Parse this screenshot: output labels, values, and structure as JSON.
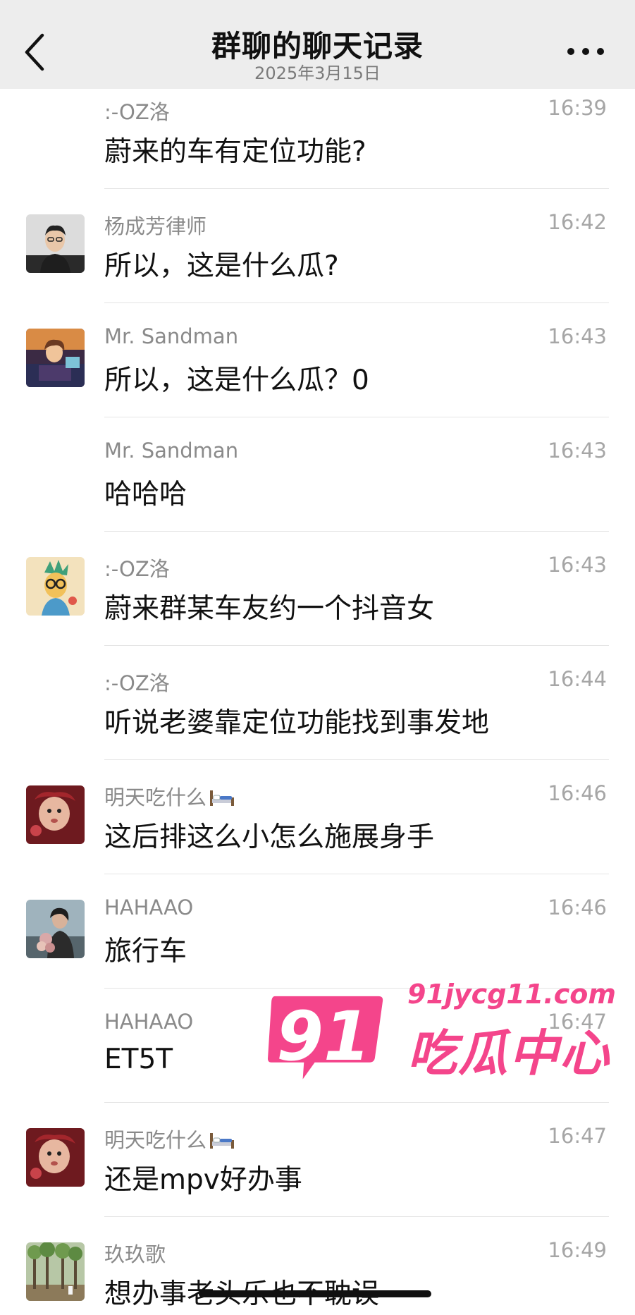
{
  "header": {
    "title": "群聊的聊天记录",
    "date": "2025年3月15日"
  },
  "messages": [
    {
      "sender": ":-OZ洛",
      "time": "16:39",
      "text": "蔚来的车有定位功能?",
      "avatar": "none"
    },
    {
      "sender": "杨成芳律师",
      "time": "16:42",
      "text": "所以，这是什么瓜?",
      "avatar": "portrait-man-glasses"
    },
    {
      "sender": "Mr. Sandman",
      "time": "16:43",
      "text": "所以，这是什么瓜？0",
      "avatar": "anime-character"
    },
    {
      "sender": "Mr. Sandman",
      "time": "16:43",
      "text": "哈哈哈",
      "avatar": "none"
    },
    {
      "sender": ":-OZ洛",
      "time": "16:43",
      "text": "蔚来群某车友约一个抖音女",
      "avatar": "cartoon-glasses"
    },
    {
      "sender": ":-OZ洛",
      "time": "16:44",
      "text": "听说老婆靠定位功能找到事发地",
      "avatar": "none"
    },
    {
      "sender": "明天吃什么",
      "time": "16:46",
      "text": "这后排这么小怎么施展身手",
      "avatar": "baby-red",
      "sender_icon": "bed-icon"
    },
    {
      "sender": "HAHAAO",
      "time": "16:46",
      "text": "旅行车",
      "avatar": "woman-flowers"
    },
    {
      "sender": "HAHAAO",
      "time": "16:47",
      "text": "ET5T",
      "avatar": "none"
    },
    {
      "sender": "明天吃什么",
      "time": "16:47",
      "text": "还是mpv好办事",
      "avatar": "baby-red",
      "sender_icon": "bed-icon"
    },
    {
      "sender": "玖玖歌",
      "time": "16:49",
      "text": "想办事老头乐也不耽误",
      "avatar": "trees-path"
    }
  ],
  "watermark": {
    "badge": "91",
    "url": "91jycg11.com",
    "name": "吃瓜中心",
    "color": "#f4458b"
  },
  "icons": {
    "back": "chevron-left-icon",
    "more": "more-dots-icon"
  }
}
